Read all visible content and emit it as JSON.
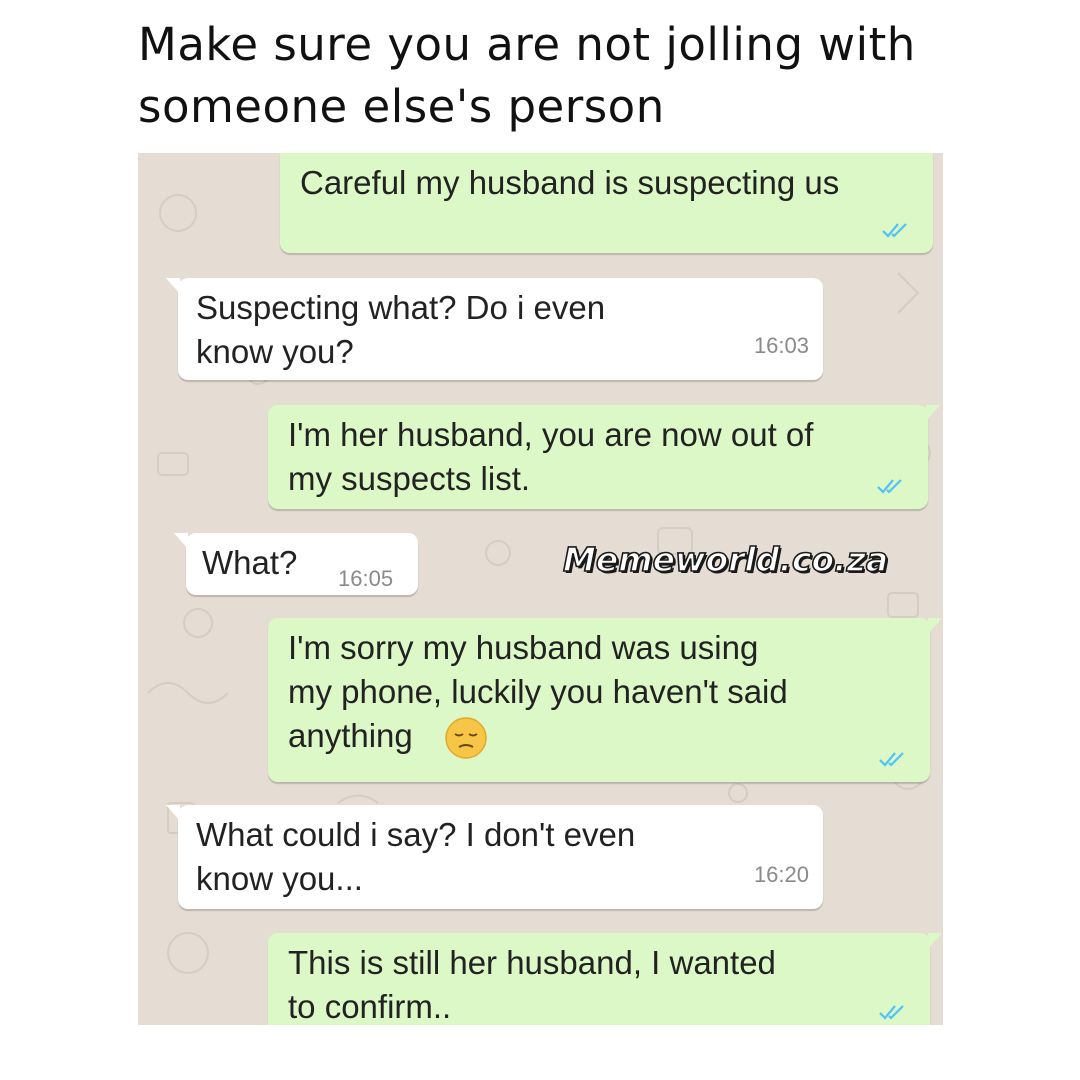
{
  "caption": "Make sure you are not jolling with someone else's person",
  "watermark": "Memeworld.co.za",
  "colors": {
    "outgoing_bubble": "#dcf8c6",
    "incoming_bubble": "#ffffff",
    "chat_background": "#e5ddd3",
    "read_ticks": "#4fc3f7"
  },
  "messages": [
    {
      "direction": "outgoing",
      "text": "Careful my husband is suspecting us",
      "status": "read-ticks-icon"
    },
    {
      "direction": "incoming",
      "text": "Suspecting what? Do i even\nknow you?",
      "time": "16:03"
    },
    {
      "direction": "outgoing",
      "text": "I'm her husband,  you are now out of\nmy suspects list.",
      "status": "read-ticks-icon"
    },
    {
      "direction": "incoming",
      "text": "What?",
      "time": "16:05"
    },
    {
      "direction": "outgoing",
      "text": "I'm sorry my husband was using\nmy phone, luckily you haven't said\nanything",
      "emoji": "pensive-face-icon",
      "status": "read-ticks-icon"
    },
    {
      "direction": "incoming",
      "text": "What could i say? I don't even\nknow you...",
      "time": "16:20"
    },
    {
      "direction": "outgoing",
      "text": "This is still her husband, I wanted\nto confirm..",
      "status": "read-ticks-icon"
    }
  ]
}
